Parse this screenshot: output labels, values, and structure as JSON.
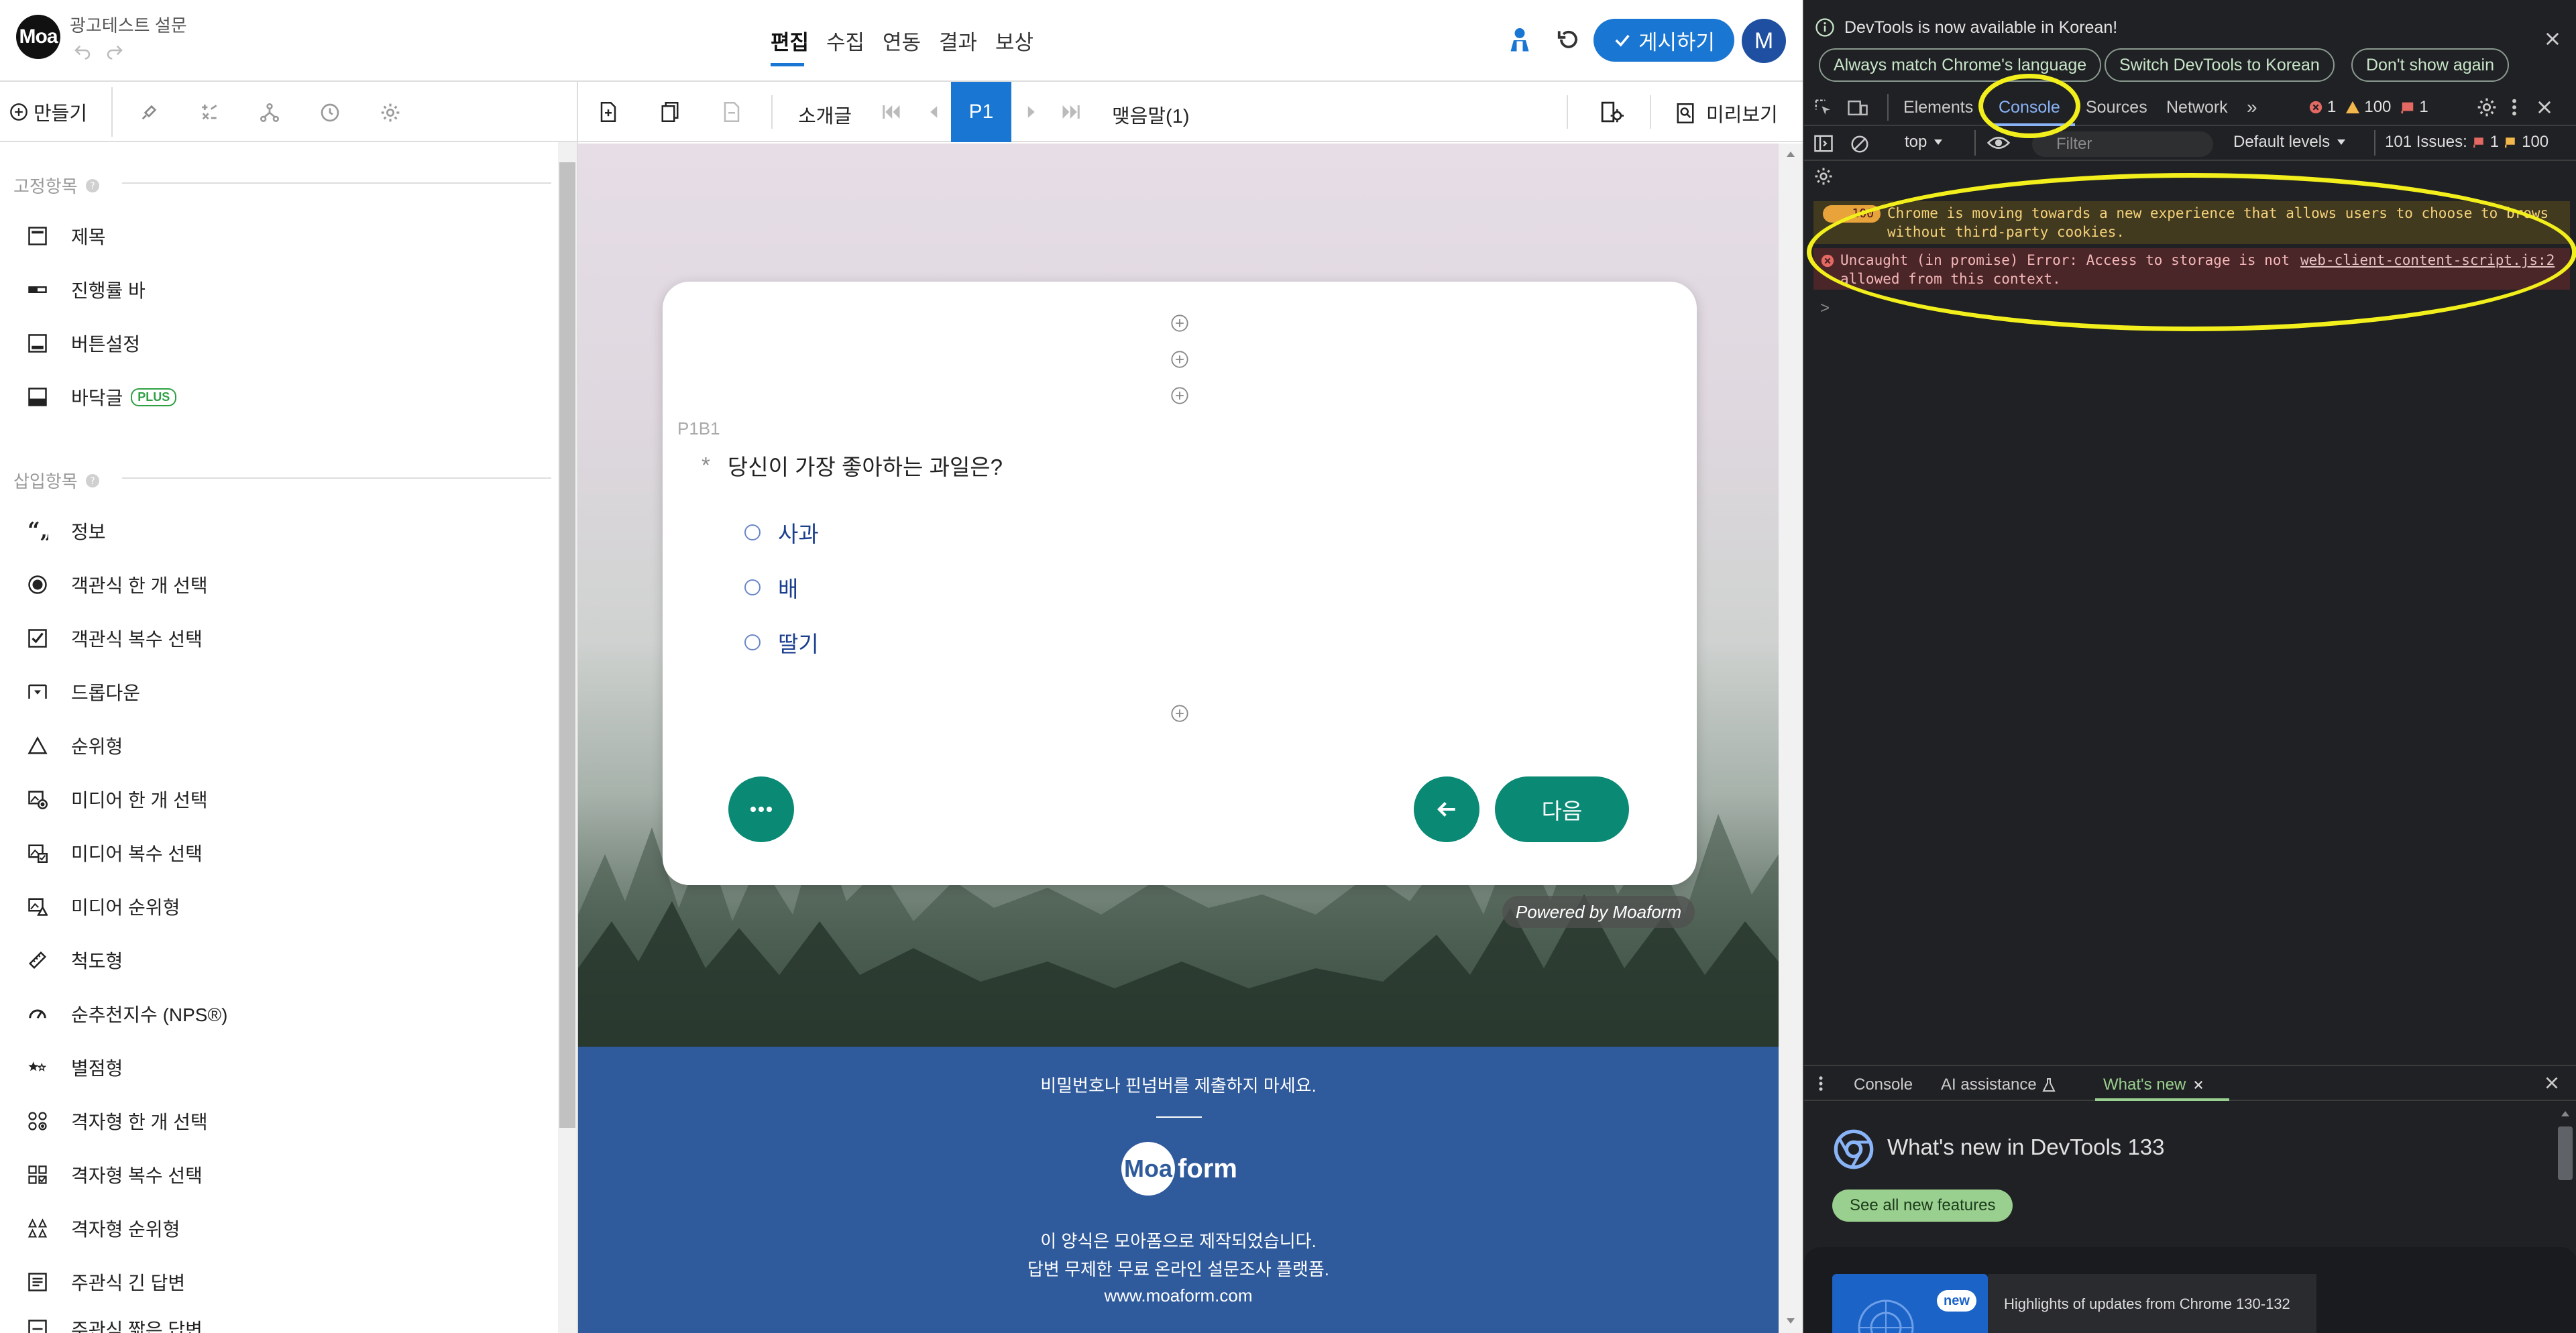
{
  "app": {
    "logo_text": "Moa",
    "doc_title": "광고테스트 설문",
    "nav": [
      "편집",
      "수집",
      "연동",
      "결과",
      "보상"
    ],
    "nav_active": "편집",
    "publish_label": "게시하기",
    "avatar_letter": "M"
  },
  "left_panel": {
    "create_tab": "만들기",
    "fixed_section": "고정항목",
    "fixed_items": [
      "제목",
      "진행률 바",
      "버튼설정",
      "바닥글"
    ],
    "plus_badge": "PLUS",
    "insert_section": "삽입항목",
    "insert_items": [
      "정보",
      "객관식 한 개 선택",
      "객관식 복수 선택",
      "드롭다운",
      "순위형",
      "미디어 한 개 선택",
      "미디어 복수 선택",
      "미디어 순위형",
      "척도형",
      "순추천지수 (NPS®)",
      "별점형",
      "격자형 한 개 선택",
      "격자형 복수 선택",
      "격자형 순위형",
      "주관식 긴 답변",
      "주관식 짧은 답변"
    ]
  },
  "center": {
    "toolbar": {
      "intro": "소개글",
      "page": "P1",
      "outro": "맺음말(1)",
      "preview": "미리보기"
    },
    "question": {
      "id": "P1B1",
      "required_mark": "*",
      "text": "당신이 가장 좋아하는 과일은?",
      "options": [
        "사과",
        "배",
        "딸기"
      ]
    },
    "next_label": "다음",
    "powered_by": "Powered by Moaform",
    "footer": {
      "warning": "비밀번호나 핀넘버를 제출하지 마세요.",
      "brand_o": "Moa",
      "brand_rest": "form",
      "line1": "이 양식은 모아폼으로 제작되었습니다.",
      "line2": "답변 무제한 무료 온라인 설문조사 플랫폼.",
      "url": "www.moaform.com"
    }
  },
  "devtools": {
    "info_banner": "DevTools is now available in Korean!",
    "btn_match": "Always match Chrome's language",
    "btn_switch": "Switch DevTools to Korean",
    "btn_dont": "Don't show again",
    "tabs": [
      "Elements",
      "Console",
      "Sources",
      "Network"
    ],
    "active_tab": "Console",
    "error_count": "1",
    "warn_count": "100",
    "issue_count": "1",
    "context": "top",
    "filter_placeholder": "Filter",
    "levels": "Default levels",
    "issues_label": "101 Issues:",
    "issues_err": "1",
    "issues_warn": "100",
    "msg1_badge": "100",
    "msg1_line1": "Chrome is moving towards a new experience that allows users to choose to brows",
    "msg1_line2": "without third-party cookies.",
    "msg2_line1": "Uncaught (in promise) Error: Access to storage is not",
    "msg2_line2": "allowed from this context.",
    "msg2_source": "web-client-content-script.js:2",
    "prompt": ">",
    "drawer_tabs": [
      "Console",
      "AI assistance",
      "What's new"
    ],
    "whats_new_title": "What's new in DevTools 133",
    "see_all": "See all new features",
    "new_badge": "new",
    "highlights": "Highlights of updates from Chrome 130-132"
  },
  "colors": {
    "accent": "#1976d2",
    "button_green": "#0a8a74",
    "footer_blue": "#2f5a9c",
    "highlight_yellow": "#f2ef1c"
  }
}
